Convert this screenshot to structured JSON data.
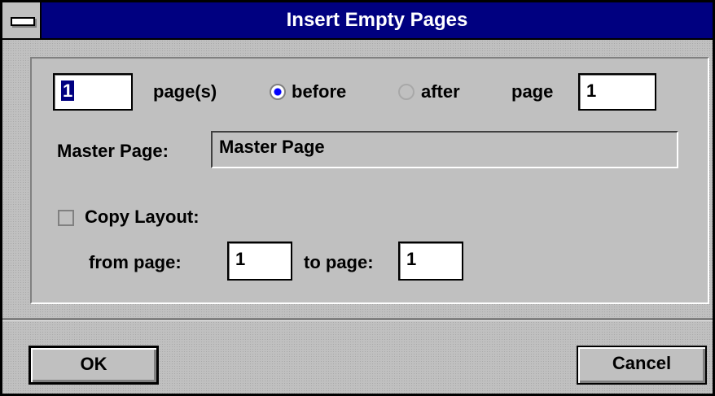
{
  "window": {
    "title": "Insert Empty Pages"
  },
  "insert": {
    "count_value": "1",
    "pages_label": "page(s)",
    "position_options": [
      {
        "label": "before",
        "selected": true
      },
      {
        "label": "after",
        "selected": false
      }
    ],
    "page_label": "page",
    "page_value": "1"
  },
  "master_page": {
    "label": "Master Page:",
    "value": "Master Page"
  },
  "copy_layout": {
    "label": "Copy Layout:",
    "checked": false,
    "from_label": "from page:",
    "from_value": "1",
    "to_label": "to page:",
    "to_value": "1"
  },
  "buttons": {
    "ok_label": "OK",
    "cancel_label": "Cancel"
  },
  "icons": {
    "system_menu": "system-menu-icon",
    "radio_on": "radio-selected-icon",
    "radio_off": "radio-unselected-icon",
    "checkbox": "checkbox-unchecked-icon"
  },
  "colors": {
    "titlebar": "#000080",
    "face": "#c0c0c0",
    "radio_dot": "#0000ff"
  }
}
